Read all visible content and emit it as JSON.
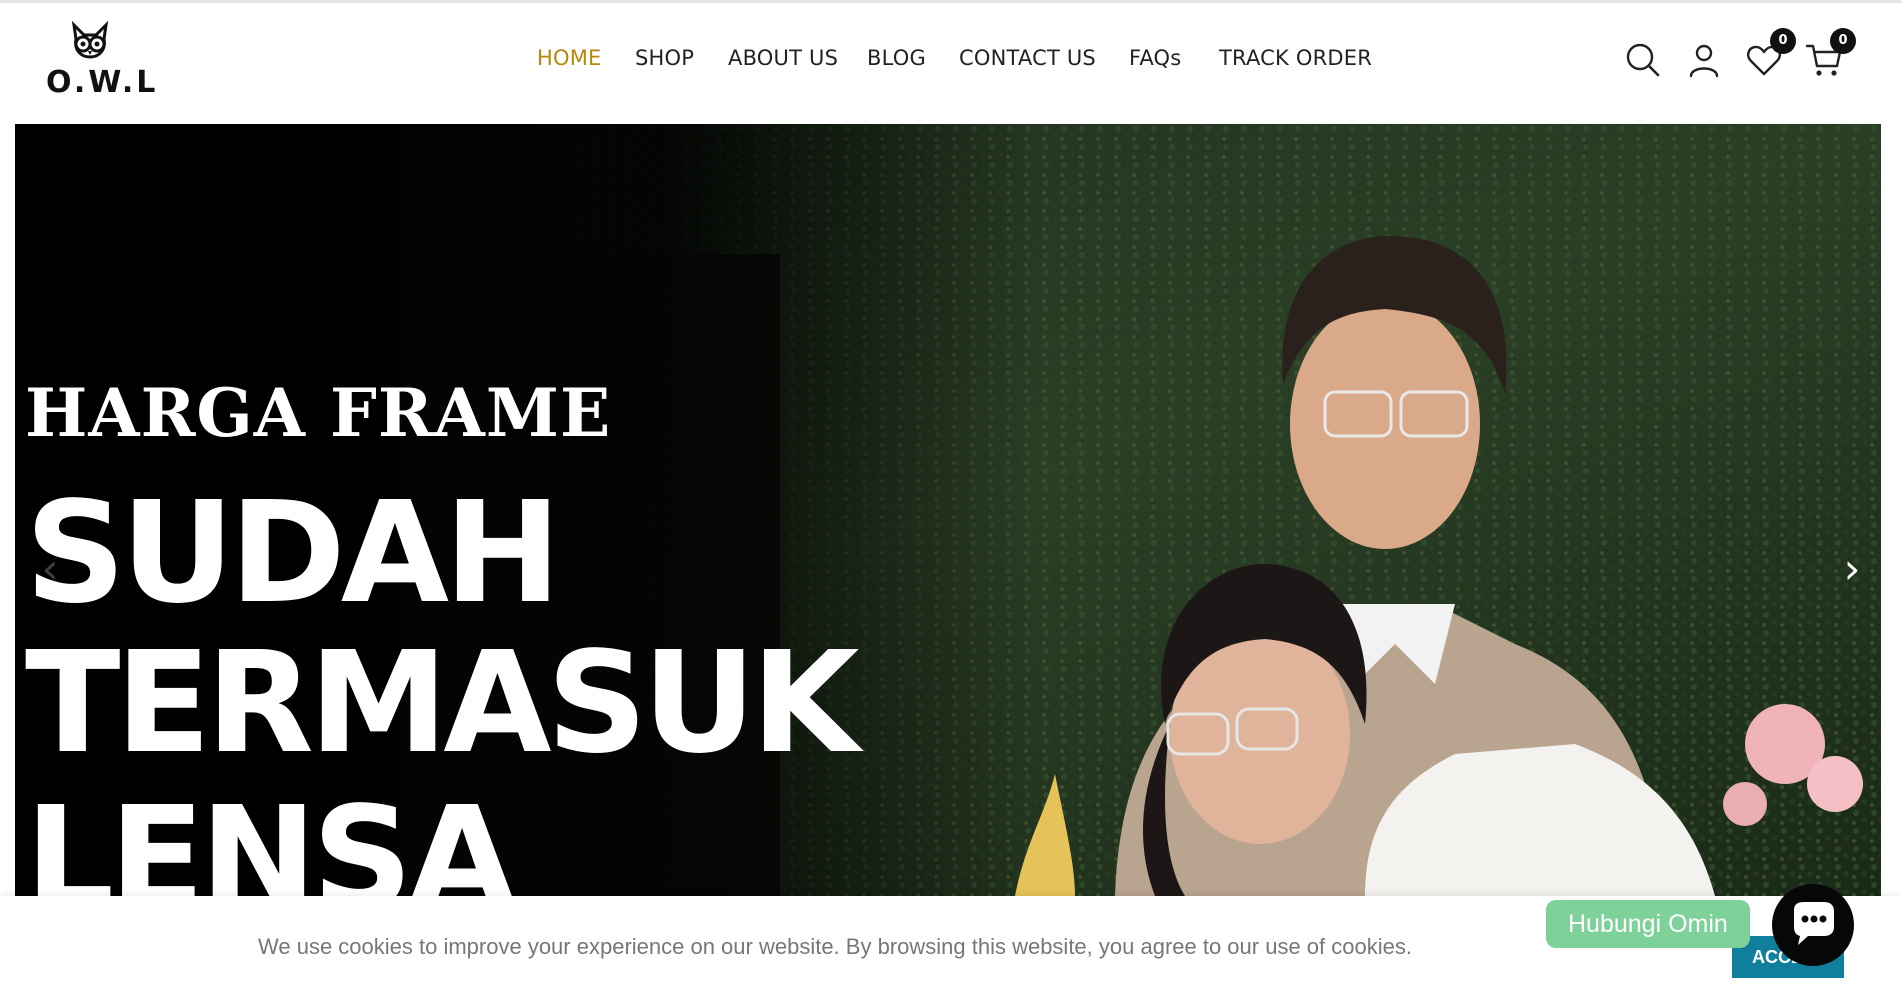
{
  "header": {
    "logo_text": "O.W.L",
    "nav": [
      {
        "label": "HOME",
        "active": true
      },
      {
        "label": "SHOP",
        "active": false
      },
      {
        "label": "ABOUT US",
        "active": false
      },
      {
        "label": "BLOG",
        "active": false
      },
      {
        "label": "CONTACT US",
        "active": false
      },
      {
        "label": "FAQs",
        "active": false
      },
      {
        "label": "TRACK ORDER",
        "active": false
      }
    ],
    "icons": {
      "search": "search-icon",
      "account": "user-icon",
      "wishlist": "heart-icon",
      "cart": "cart-icon"
    },
    "wishlist_count": "0",
    "cart_count": "0",
    "active_color": "#b8860b"
  },
  "hero": {
    "line1": "HARGA FRAME",
    "line2": "SUDAH",
    "line3": "TERMASUK",
    "line4": "LENSA",
    "prev_icon": "‹",
    "next_icon": "›"
  },
  "cookie": {
    "text": "We use cookies to improve your experience on our website. By browsing this website, you agree to our use of cookies.",
    "accept_label": "ACCEPT",
    "accept_color": "#0f7f9b"
  },
  "chat": {
    "label": "Hubungi Omin",
    "label_color": "#7fd19a",
    "icon": "chat-icon"
  }
}
